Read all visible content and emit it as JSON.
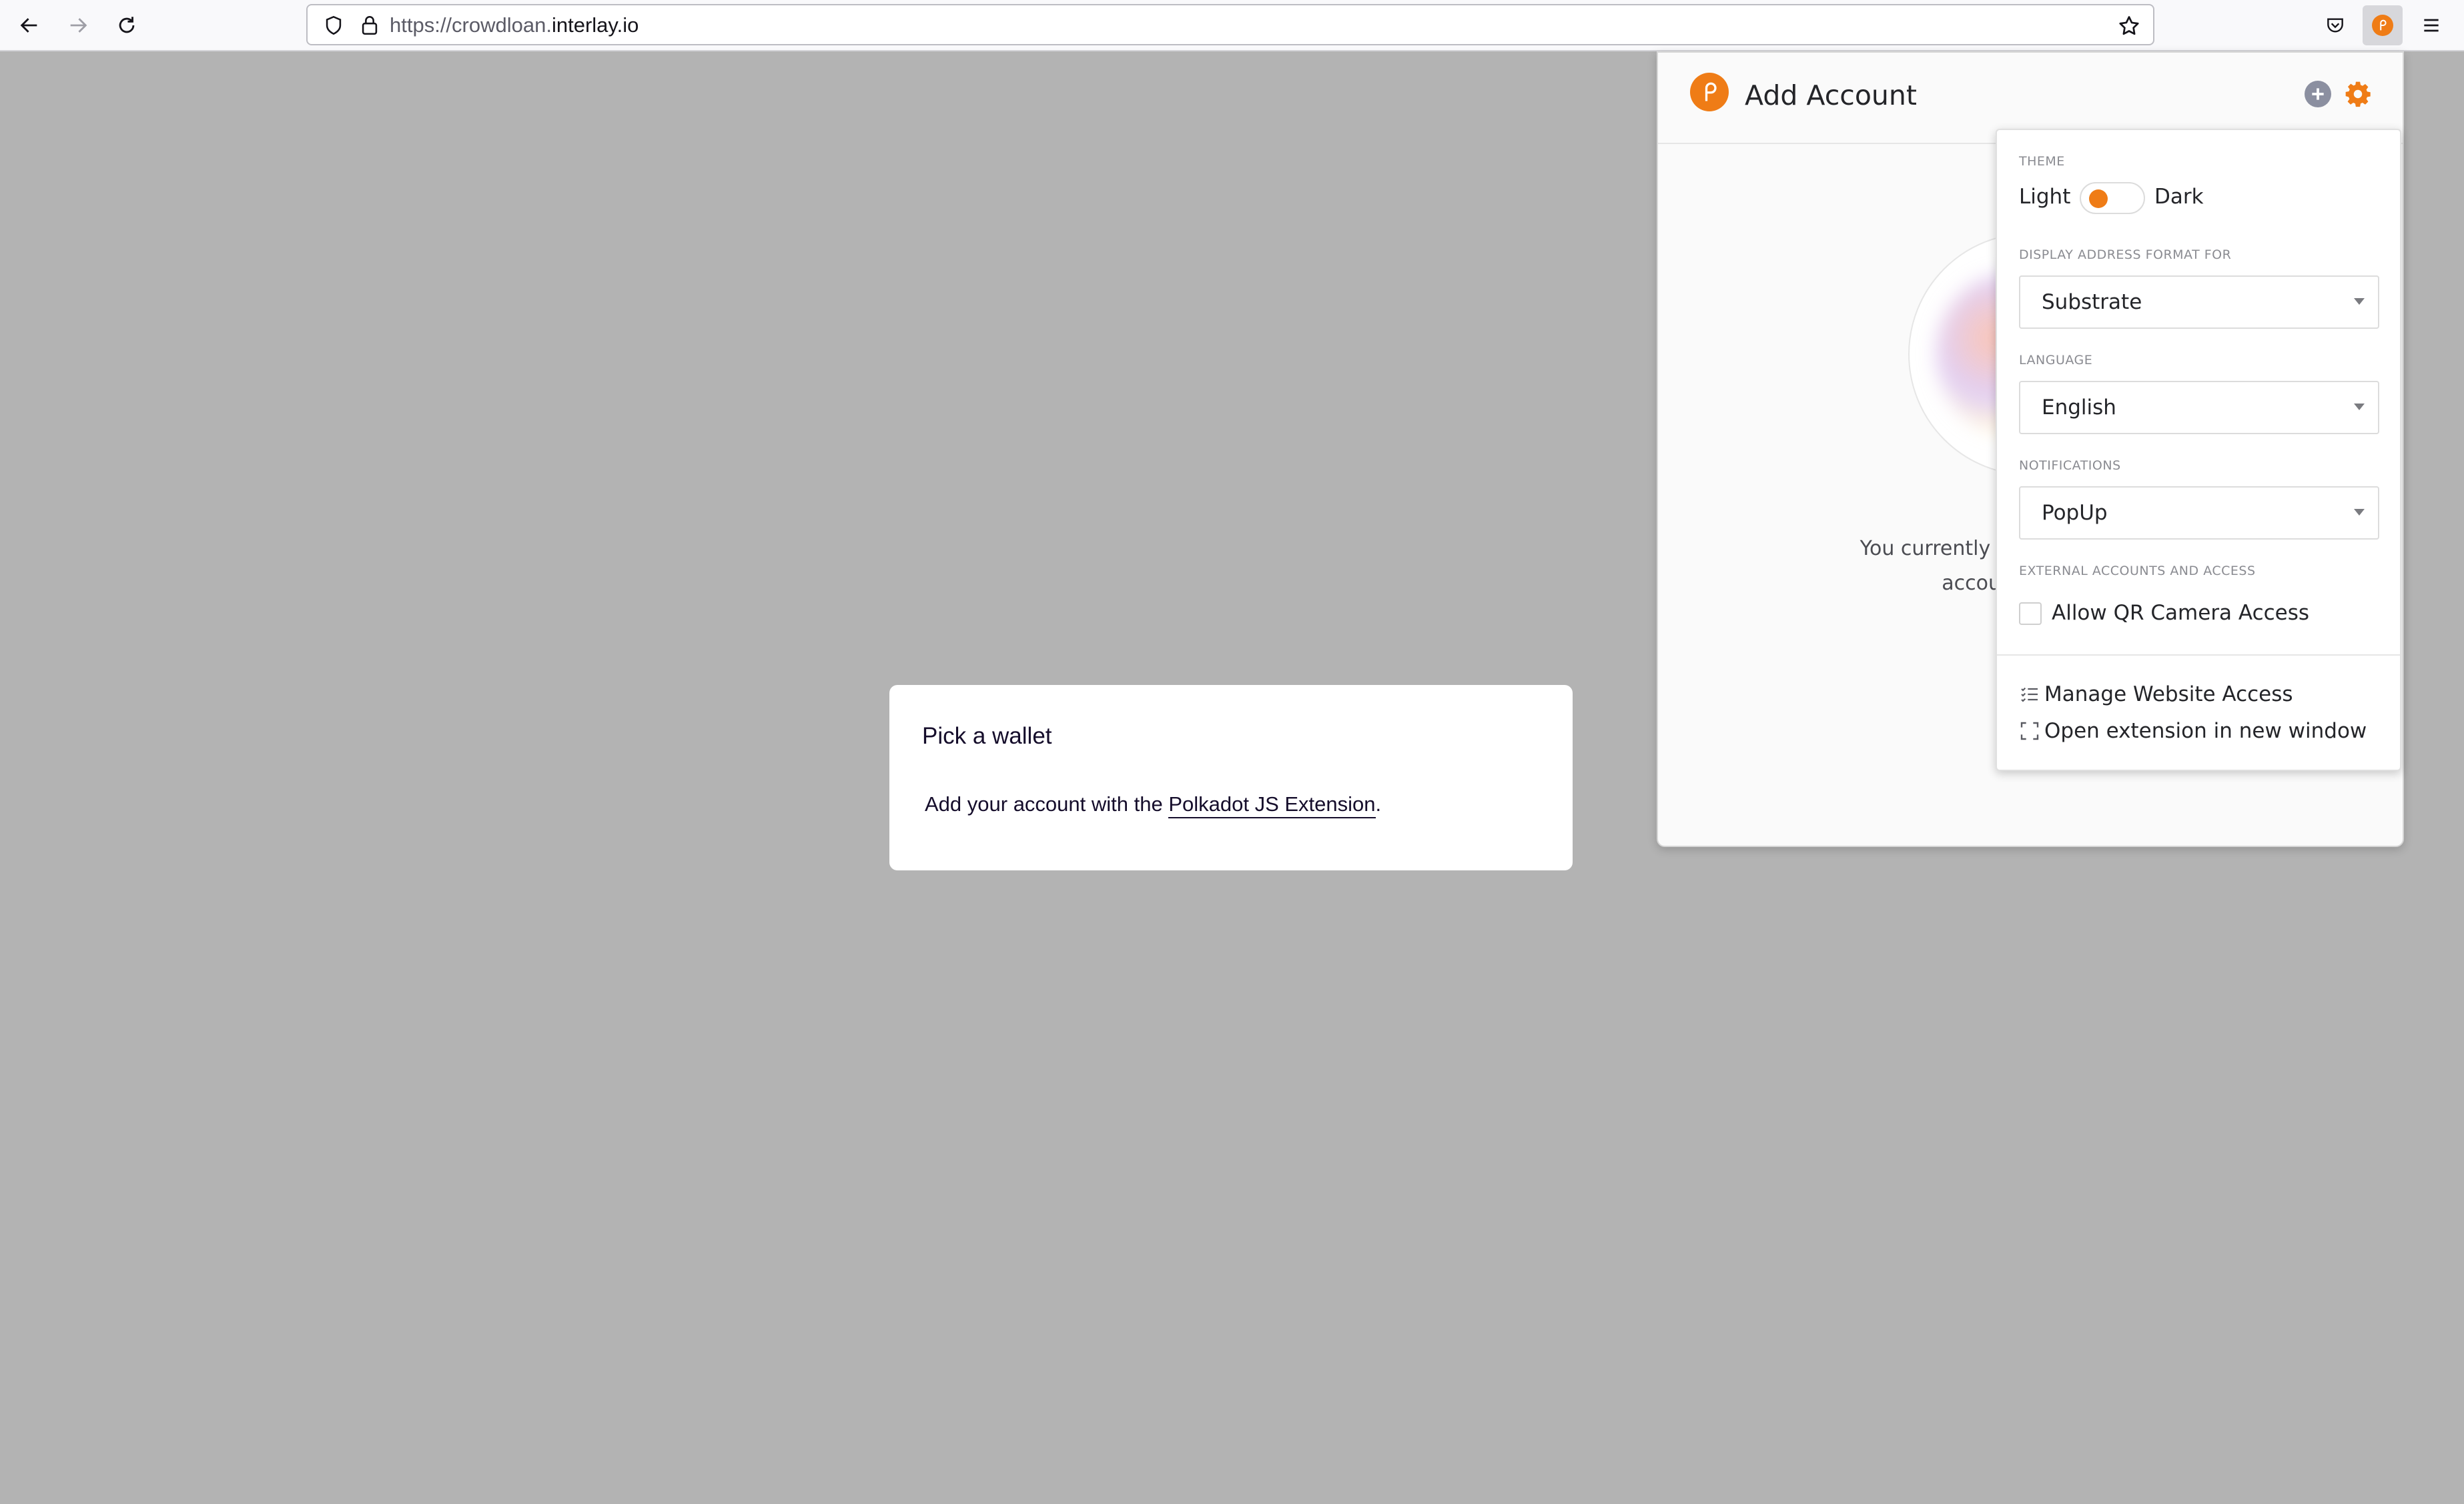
{
  "browser": {
    "url_scheme": "https://",
    "url_subdomain": "crowdloan.",
    "url_domain": "interlay.io",
    "icons": [
      "back-icon",
      "forward-icon",
      "reload-icon",
      "shield-icon",
      "lock-icon",
      "bookmark-star-icon",
      "pocket-icon",
      "polkadot-extension-icon",
      "menu-icon"
    ]
  },
  "wallet_modal": {
    "title": "Pick a wallet",
    "desc_prefix": "Add your account with the ",
    "link_text": "Polkadot JS Extension",
    "desc_suffix": "."
  },
  "popup": {
    "title": "Add Account",
    "empty_line1": "You currently don't have",
    "empty_line2": "account",
    "accent_color": "#ef7c16"
  },
  "settings": {
    "theme_label": "THEME",
    "theme_light": "Light",
    "theme_dark": "Dark",
    "theme_selected": "Light",
    "address_format_label": "DISPLAY ADDRESS FORMAT FOR",
    "address_format_value": "Substrate",
    "language_label": "LANGUAGE",
    "language_value": "English",
    "notifications_label": "NOTIFICATIONS",
    "notifications_value": "PopUp",
    "external_label": "EXTERNAL ACCOUNTS AND ACCESS",
    "qr_label": "Allow QR Camera Access",
    "qr_checked": false,
    "manage_access": "Manage Website Access",
    "open_window": "Open extension in new window"
  }
}
